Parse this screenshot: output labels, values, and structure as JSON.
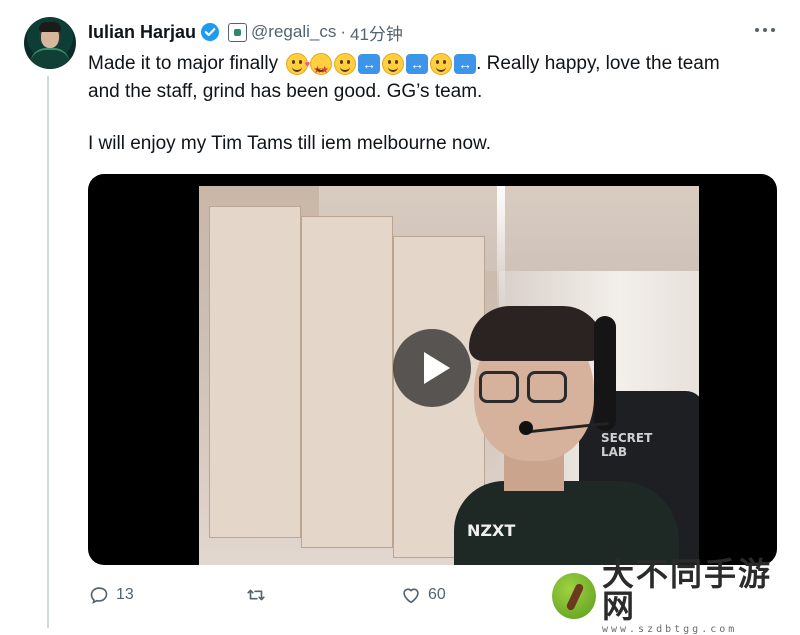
{
  "author": {
    "name": "Iulian Harjau",
    "handle": "@regali_cs",
    "separator": "·",
    "time": "41分钟"
  },
  "tweet": {
    "line1_prefix": "Made it to major finally",
    "line1_suffix": ". Really happy, love the team",
    "line2": "and the staff, grind has been good. GG’s team.",
    "line3": "I will enjoy my Tim Tams till iem melbourne now.",
    "emojis": [
      "smiling-face-with-hearts",
      "star-struck",
      "slightly-smiling-face",
      "left-right-arrow",
      "slightly-smiling-face",
      "left-right-arrow",
      "slightly-smiling-face",
      "left-right-arrow"
    ]
  },
  "media": {
    "chair_text": "SECRET\nLAB",
    "jersey_text": "NZXT"
  },
  "actions": {
    "replies": "13",
    "likes": "60"
  },
  "watermark": {
    "title": "大不同手游网",
    "subtitle": "www.szdbtgg.com"
  },
  "colors": {
    "text": "#0f1419",
    "secondary": "#536471",
    "verified": "#1d9bf0"
  }
}
